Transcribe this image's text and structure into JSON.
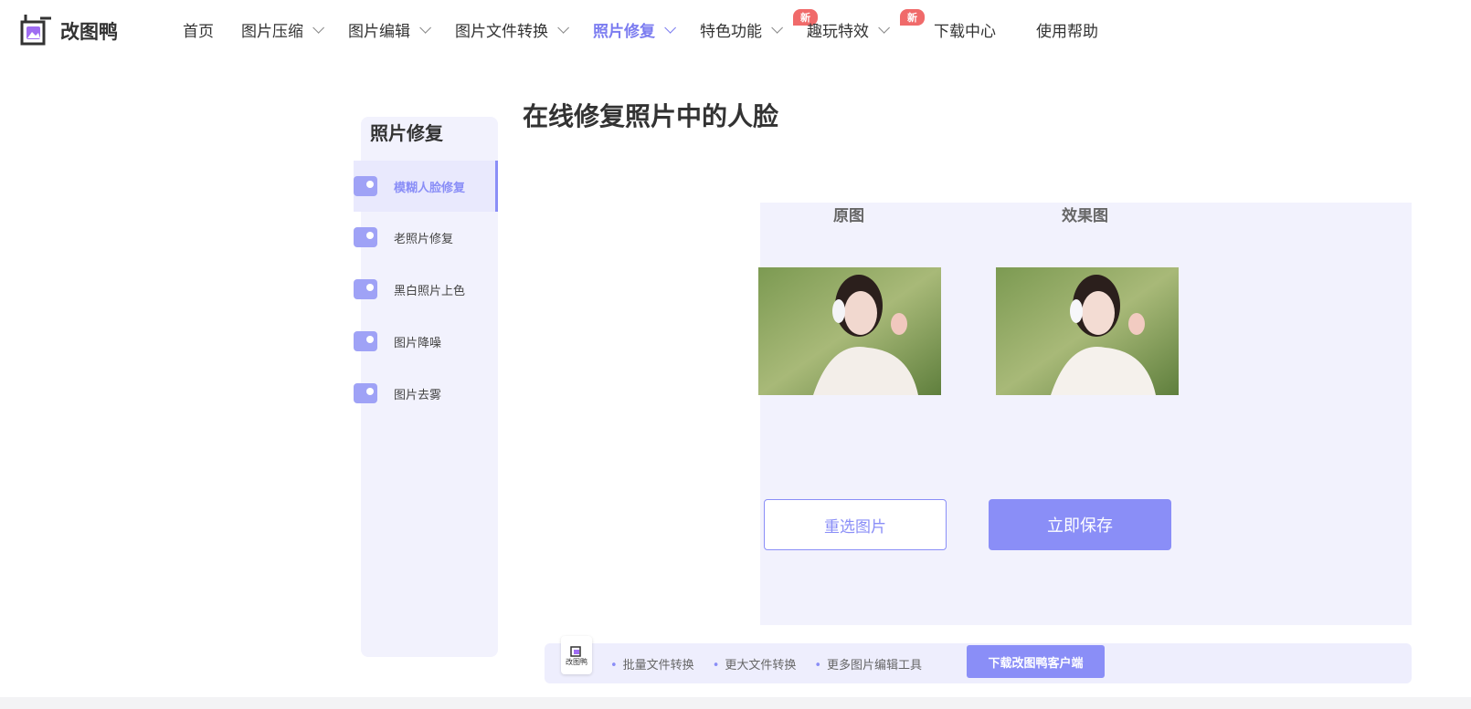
{
  "brand": {
    "name": "改图鸭",
    "accent": "#8a8ef7",
    "badge_color": "#f06a6a"
  },
  "nav": {
    "home": "首页",
    "compress": "图片压缩",
    "edit": "图片编辑",
    "convert": "图片文件转换",
    "restore": "照片修复",
    "features": "特色功能",
    "fun": "趣玩特效",
    "download": "下载中心",
    "help": "使用帮助",
    "badge_new": "新"
  },
  "sidebar": {
    "title": "照片修复",
    "items": [
      {
        "label": "模糊人脸修复",
        "icon": "face-restore-icon",
        "active": true
      },
      {
        "label": "老照片修复",
        "icon": "old-photo-icon",
        "active": false
      },
      {
        "label": "黑白照片上色",
        "icon": "colorize-icon",
        "active": false
      },
      {
        "label": "图片降噪",
        "icon": "denoise-icon",
        "active": false
      },
      {
        "label": "图片去雾",
        "icon": "dehaze-icon",
        "active": false
      }
    ]
  },
  "main": {
    "title": "在线修复照片中的人脸",
    "original_label": "原图",
    "result_label": "效果图",
    "reselect_button": "重选图片",
    "save_button": "立即保存"
  },
  "promo": {
    "logo_text": "改图鸭",
    "features": [
      "批量文件转换",
      "更大文件转换",
      "更多图片编辑工具"
    ],
    "download_button": "下载改图鸭客户端"
  }
}
